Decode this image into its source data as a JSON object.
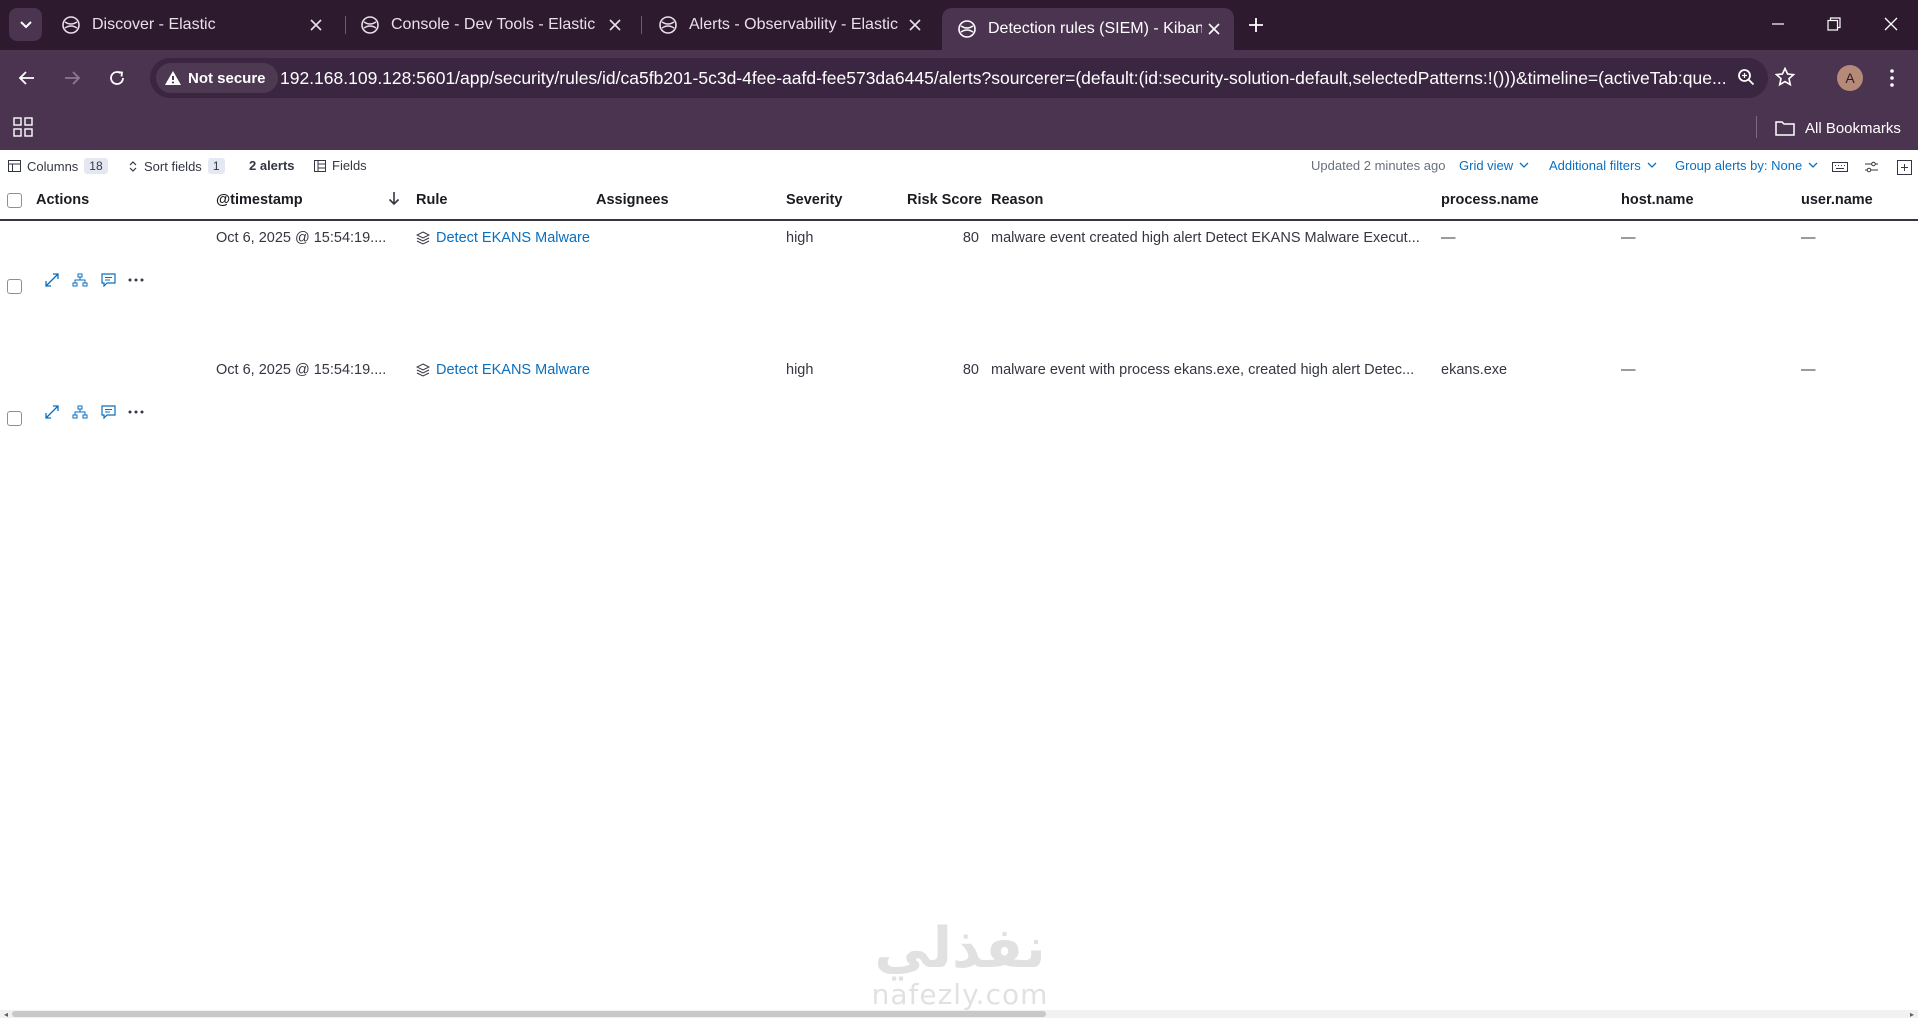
{
  "browser": {
    "tabs": [
      {
        "title": "Discover - Elastic",
        "active": false
      },
      {
        "title": "Console - Dev Tools - Elastic",
        "active": false
      },
      {
        "title": "Alerts - Observability - Elastic",
        "active": false
      },
      {
        "title": "Detection rules (SIEM) - Kibana",
        "active": true
      }
    ],
    "security_badge": "Not secure",
    "url": "192.168.109.128:5601/app/security/rules/id/ca5fb201-5c3d-4fee-aafd-fee573da6445/alerts?sourcerer=(default:(id:security-solution-default,selectedPatterns:!()))&timeline=(activeTab:que...",
    "profile_initial": "A",
    "all_bookmarks_label": "All Bookmarks"
  },
  "grid_toolbar": {
    "columns_label": "Columns",
    "columns_count": "18",
    "sort_label": "Sort fields",
    "sort_count": "1",
    "alerts_count_label": "2 alerts",
    "fields_label": "Fields",
    "updated_label": "Updated 2 minutes ago",
    "grid_view_label": "Grid view",
    "additional_filters_label": "Additional filters",
    "group_alerts_label": "Group alerts by: None"
  },
  "table": {
    "headers": {
      "actions": "Actions",
      "timestamp": "@timestamp",
      "rule": "Rule",
      "assignees": "Assignees",
      "severity": "Severity",
      "risk_score": "Risk Score",
      "reason": "Reason",
      "process_name": "process.name",
      "host_name": "host.name",
      "user_name": "user.name"
    },
    "rows": [
      {
        "timestamp": "Oct 6, 2025 @ 15:54:19....",
        "rule": "Detect EKANS Malware",
        "assignees": "",
        "severity": "high",
        "risk_score": "80",
        "reason": "malware event created high alert Detect EKANS Malware Execut...",
        "process_name": "—",
        "host_name": "—",
        "user_name": "—"
      },
      {
        "timestamp": "Oct 6, 2025 @ 15:54:19....",
        "rule": "Detect EKANS Malware",
        "assignees": "",
        "severity": "high",
        "risk_score": "80",
        "reason": "malware event with process ekans.exe, created high alert Detec...",
        "process_name": "ekans.exe",
        "host_name": "—",
        "user_name": "—"
      }
    ]
  },
  "watermark": {
    "arabic": "نفذلي",
    "latin": "nafezly.com"
  },
  "colors": {
    "browser_frame": "#2d1a2f",
    "toolbar": "#4a3450",
    "link": "#0a6fbf",
    "text": "#343741"
  }
}
